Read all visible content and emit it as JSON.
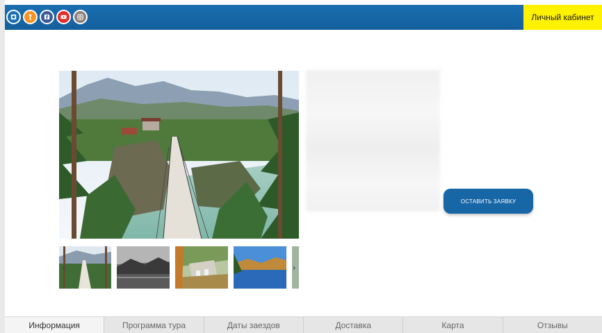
{
  "header": {
    "social": [
      {
        "name": "vk-icon",
        "color": "#ffffff",
        "bg": "#1a6fb0"
      },
      {
        "name": "odnoklassniki-icon",
        "color": "#ffffff",
        "bg": "#f7931e"
      },
      {
        "name": "facebook-icon",
        "color": "#ffffff",
        "bg": "#3b5998"
      },
      {
        "name": "youtube-icon",
        "color": "#ffffff",
        "bg": "#e52d27"
      },
      {
        "name": "instagram-icon",
        "color": "#ffffff",
        "bg": "#8a7f7a"
      }
    ],
    "cabinet_label": "Личный кабинет",
    "cabinet_color": "#fff200"
  },
  "order_button": {
    "label": "ОСТАВИТЬ ЗАЯВКУ",
    "color": "#1766a6"
  },
  "tabs": [
    {
      "label": "Информация",
      "active": true
    },
    {
      "label": "Программа тура",
      "active": false
    },
    {
      "label": "Даты заездов",
      "active": false
    },
    {
      "label": "Доставка",
      "active": false
    },
    {
      "label": "Карта",
      "active": false
    },
    {
      "label": "Отзывы",
      "active": false
    }
  ],
  "gallery": {
    "prev_icon": "chevron-left-icon",
    "next_icon": "chevron-right-icon",
    "prev_glyph": "‹",
    "next_glyph": "›"
  }
}
